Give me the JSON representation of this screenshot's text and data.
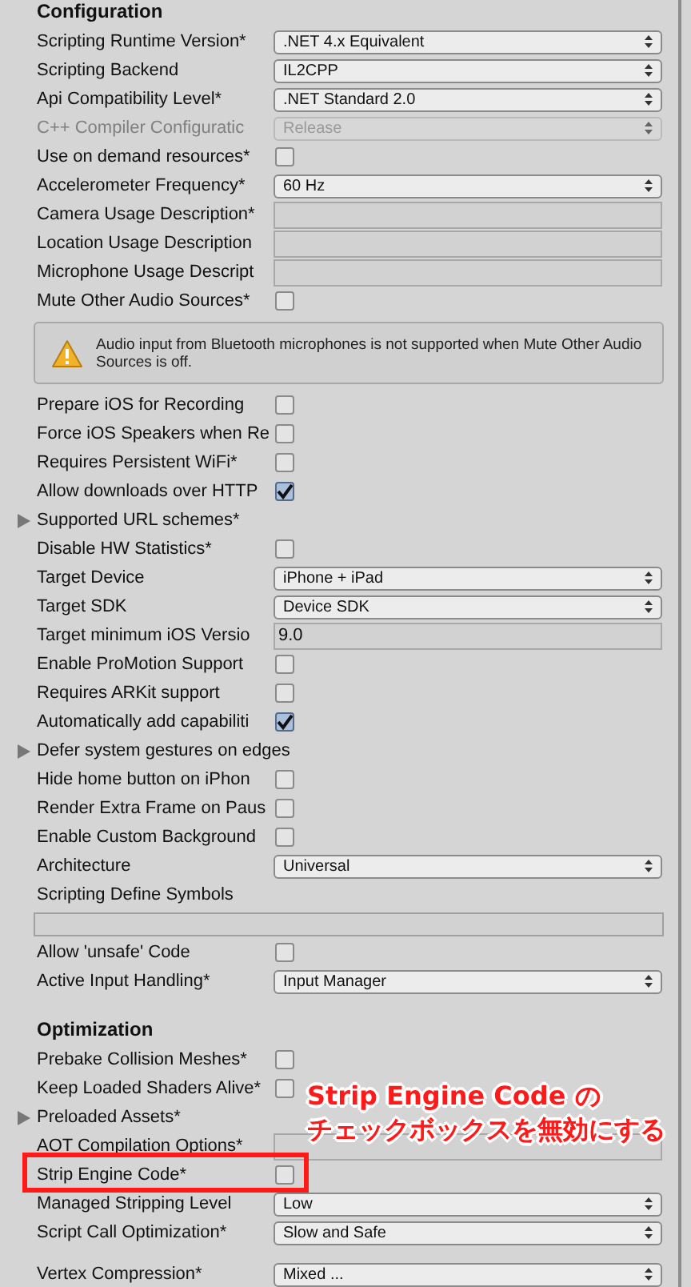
{
  "sections": [
    {
      "heading": "Configuration",
      "rows": [
        {
          "kind": "dropdown",
          "label": "Scripting Runtime Version*",
          "value": ".NET 4.x Equivalent",
          "disabled": false,
          "highlighted": false
        },
        {
          "kind": "dropdown",
          "label": "Scripting Backend",
          "value": "IL2CPP",
          "disabled": false,
          "highlighted": false
        },
        {
          "kind": "dropdown",
          "label": "Api Compatibility Level*",
          "value": ".NET Standard 2.0",
          "disabled": false,
          "highlighted": false
        },
        {
          "kind": "dropdown",
          "label": "C++ Compiler Configuratic",
          "value": "Release",
          "disabled": true,
          "highlighted": false
        },
        {
          "kind": "checkbox",
          "label": "Use on demand resources*",
          "checked": false,
          "highlighted": false
        },
        {
          "kind": "dropdown",
          "label": "Accelerometer Frequency*",
          "value": "60 Hz",
          "disabled": false,
          "highlighted": false
        },
        {
          "kind": "text",
          "label": "Camera Usage Description*",
          "highlighted": false
        },
        {
          "kind": "text",
          "label": "Location Usage Description",
          "highlighted": false
        },
        {
          "kind": "text",
          "label": "Microphone Usage Descript",
          "highlighted": false
        },
        {
          "kind": "checkbox",
          "label": "Mute Other Audio Sources*",
          "checked": false,
          "highlighted": false
        },
        {
          "kind": "help",
          "text": "Audio input from Bluetooth microphones is not supported when Mute Other Audio Sources is off.",
          "highlighted": false
        },
        {
          "kind": "checkbox",
          "label": "Prepare iOS for Recording",
          "checked": false,
          "highlighted": false
        },
        {
          "kind": "checkbox",
          "label": "Force iOS Speakers when Re",
          "checked": false,
          "highlighted": false
        },
        {
          "kind": "checkbox",
          "label": "Requires Persistent WiFi*",
          "checked": false,
          "highlighted": false
        },
        {
          "kind": "checkbox",
          "label": "Allow downloads over HTTP",
          "checked": true,
          "highlighted": false
        },
        {
          "kind": "foldout",
          "label": "Supported URL schemes*",
          "highlighted": false
        },
        {
          "kind": "checkbox",
          "label": "Disable HW Statistics*",
          "checked": false,
          "highlighted": false
        },
        {
          "kind": "dropdown",
          "label": "Target Device",
          "value": "iPhone + iPad",
          "disabled": false,
          "highlighted": false
        },
        {
          "kind": "dropdown",
          "label": "Target SDK",
          "value": "Device SDK",
          "disabled": false,
          "highlighted": false
        },
        {
          "kind": "text",
          "label": "Target minimum iOS Versio",
          "value": "9.0",
          "highlighted": false
        },
        {
          "kind": "checkbox",
          "label": "Enable ProMotion Support",
          "checked": false,
          "highlighted": false
        },
        {
          "kind": "checkbox",
          "label": "Requires ARKit support",
          "checked": false,
          "highlighted": false
        },
        {
          "kind": "checkbox",
          "label": "Automatically add capabiliti",
          "checked": true,
          "highlighted": false
        },
        {
          "kind": "foldout",
          "label": "Defer system gestures on edges",
          "highlighted": false
        },
        {
          "kind": "checkbox",
          "label": "Hide home button on iPhon",
          "checked": false,
          "highlighted": false
        },
        {
          "kind": "checkbox",
          "label": "Render Extra Frame on Paus",
          "checked": false,
          "highlighted": false
        },
        {
          "kind": "checkbox",
          "label": "Enable Custom Background",
          "checked": false,
          "highlighted": false
        },
        {
          "kind": "dropdown",
          "label": "Architecture",
          "value": "Universal",
          "disabled": false,
          "highlighted": false
        },
        {
          "kind": "label",
          "label": "Scripting Define Symbols",
          "highlighted": false
        },
        {
          "kind": "wide_text",
          "highlighted": false
        },
        {
          "kind": "checkbox",
          "label": "Allow 'unsafe' Code",
          "checked": false,
          "highlighted": false
        },
        {
          "kind": "dropdown",
          "label": "Active Input Handling*",
          "value": "Input Manager",
          "disabled": false,
          "highlighted": false
        }
      ]
    },
    {
      "heading": "Optimization",
      "rows": [
        {
          "kind": "checkbox",
          "label": "Prebake Collision Meshes*",
          "checked": false,
          "highlighted": false
        },
        {
          "kind": "checkbox",
          "label": "Keep Loaded Shaders Alive*",
          "checked": false,
          "highlighted": false
        },
        {
          "kind": "foldout",
          "label": "Preloaded Assets*",
          "highlighted": false
        },
        {
          "kind": "text",
          "label": "AOT Compilation Options*",
          "highlighted": false
        },
        {
          "kind": "checkbox",
          "label": "Strip Engine Code*",
          "checked": false,
          "highlighted": true
        },
        {
          "kind": "dropdown",
          "label": "Managed Stripping Level",
          "value": "Low",
          "disabled": false,
          "highlighted": false
        },
        {
          "kind": "dropdown",
          "label": "Script Call Optimization*",
          "value": "Slow and Safe",
          "disabled": false,
          "highlighted": false
        },
        {
          "kind": "spacer",
          "highlighted": false
        },
        {
          "kind": "dropdown",
          "label": "Vertex Compression*",
          "value": "Mixed ...",
          "disabled": false,
          "highlighted": false
        }
      ]
    }
  ],
  "annotation": {
    "lines": [
      "Strip Engine Code の",
      "チェックボックスを無効にする"
    ]
  }
}
